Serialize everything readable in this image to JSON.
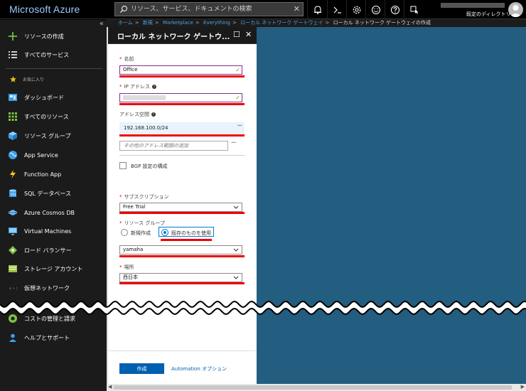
{
  "app": {
    "brand": "Microsoft Azure"
  },
  "search": {
    "placeholder": "リソース、サービス、ドキュメントの検索"
  },
  "account": {
    "directory": "既定のディレクトリ"
  },
  "topbar_icons": [
    "bell-icon",
    "cloud-shell-icon",
    "settings-icon",
    "smiley-icon",
    "help-icon",
    "feedback-icon"
  ],
  "sidebar": {
    "collapse": "«",
    "create": "リソースの作成",
    "all_services": "すべてのサービス",
    "favorites": "お気に入り",
    "items": [
      "ダッシュボード",
      "すべてのリソース",
      "リソース グループ",
      "App Service",
      "Function App",
      "SQL データベース",
      "Azure Cosmos DB",
      "Virtual Machines",
      "ロード バランサー",
      "ストレージ アカウント",
      "仮想ネットワーク"
    ],
    "bottom_items": [
      "コストの管理と請求",
      "ヘルプとサポート"
    ]
  },
  "breadcrumb": [
    "ホーム",
    "新規",
    "Marketplace",
    "Everything",
    "ローカル ネットワーク ゲートウェイ"
  ],
  "breadcrumb_current": "ローカル ネットワーク ゲートウェイの作成",
  "blade": {
    "title": "ローカル ネットワーク ゲートウ...",
    "name_label": "名前",
    "name_value": "Office",
    "ip_label": "IP アドレス",
    "address_space_label": "アドレス空間",
    "address_value": "192.168.100.0/24",
    "address_placeholder": "その他のアドレス範囲の追加",
    "bgp_label": "BGP 設定の構成",
    "subscription_label": "サブスクリプション",
    "subscription_value": "Free Trial",
    "resource_group_label": "リソース グループ",
    "rg_new": "新規作成",
    "rg_existing": "既存のものを使用",
    "rg_value": "yamaha",
    "location_label": "場所",
    "location_value": "西日本",
    "create_button": "作成",
    "automation_link": "Automation オプション"
  },
  "colors": {
    "accent": "#0060b0",
    "canvas": "#235d7f",
    "highlight": "#e00000",
    "valid": "#57a300"
  }
}
